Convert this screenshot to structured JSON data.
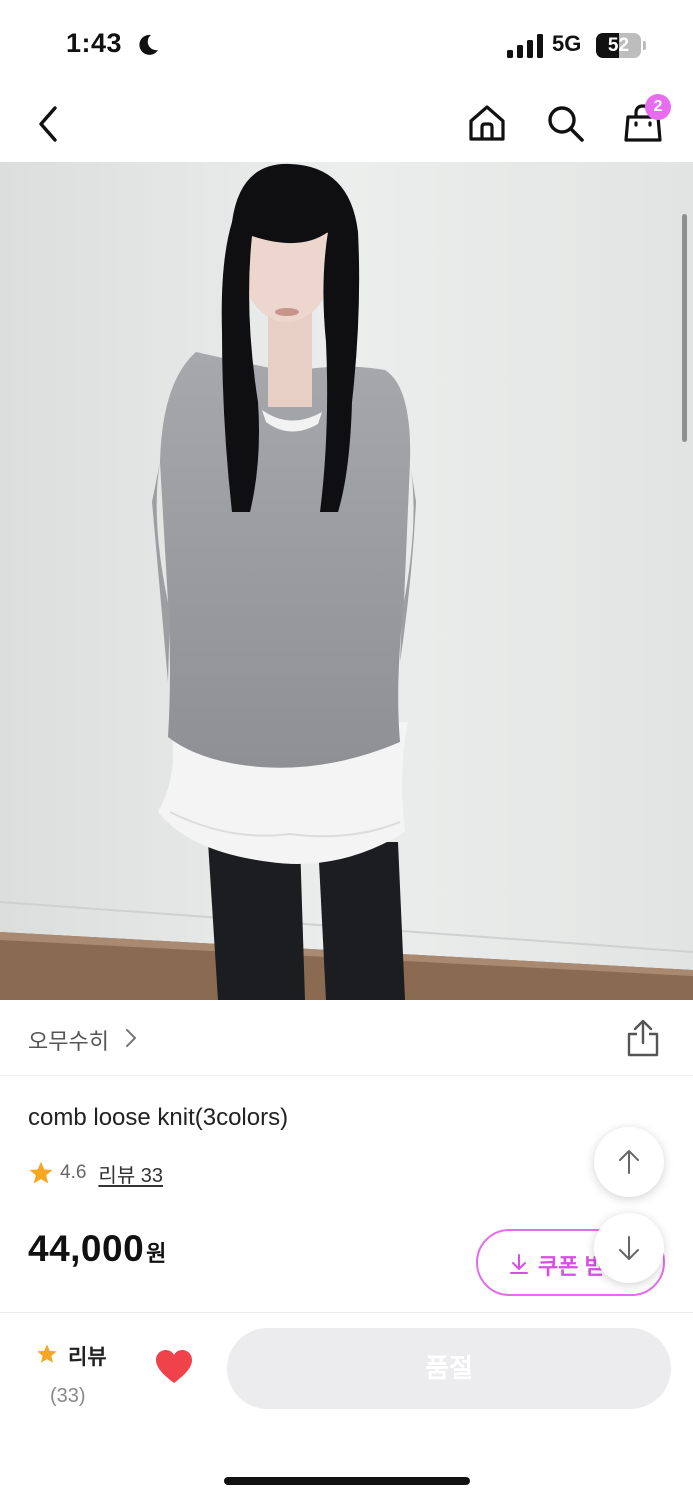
{
  "status_bar": {
    "time": "1:43",
    "network": "5G",
    "battery_level": "52",
    "moon_icon": "moon-icon",
    "signal_icon": "cellular-signal-icon"
  },
  "nav": {
    "back_icon": "chevron-left-icon",
    "home_icon": "home-icon",
    "search_icon": "search-icon",
    "cart_icon": "shopping-bag-icon",
    "cart_count": "2"
  },
  "gallery": {
    "image_count": 2,
    "active_index": 1
  },
  "brand": {
    "name": "오무수히",
    "chevron": ">"
  },
  "product": {
    "name": "comb loose knit(3colors)",
    "rating": "4.6",
    "review_link": "리뷰 33",
    "price": "44,000",
    "currency": "원"
  },
  "coupon": {
    "label": "쿠폰 받기"
  },
  "bottom_bar": {
    "review_label": "리뷰",
    "review_count": "(33)",
    "soldout_label": "품절"
  },
  "colors": {
    "accent": "#e36ee8",
    "badge": "#e96cf0",
    "star": "#f5a623",
    "heart": "#f0424a",
    "soldout_bg": "#ececee"
  }
}
